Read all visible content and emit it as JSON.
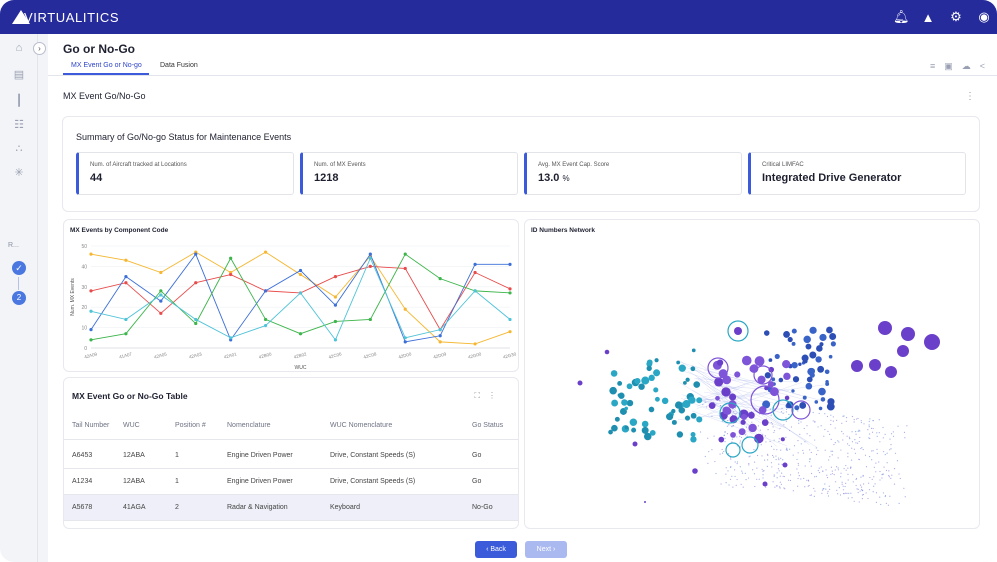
{
  "app": {
    "brand": "VIRTUALITICS",
    "top_icons": [
      "bell-icon",
      "alert-icon",
      "settings-icon",
      "user-icon"
    ]
  },
  "header": {
    "title": "Go or No-Go",
    "tabs": [
      {
        "label": "MX Event Go or No-go",
        "active": true
      },
      {
        "label": "Data Fusion",
        "active": false
      }
    ],
    "tools": [
      "filter-icon",
      "comment-icon",
      "cloud-icon",
      "share-icon"
    ]
  },
  "rail": {
    "items": [
      "home-icon",
      "document-icon",
      "bar-chart-icon",
      "dashboard-icon",
      "network-icon",
      "hub-icon"
    ],
    "step_label": "R...",
    "step_number": "2"
  },
  "section": {
    "title": "MX Event Go/No-Go"
  },
  "summary": {
    "title": "Summary of Go/No-go Status for Maintenance Events",
    "kpis": [
      {
        "label": "Num. of Aircraft tracked at Locations",
        "value": "44",
        "unit": ""
      },
      {
        "label": "Num. of MX Events",
        "value": "1218",
        "unit": ""
      },
      {
        "label": "Avg. MX Event Cap. Score",
        "value": "13.0",
        "unit": "%"
      },
      {
        "label": "Critical LIMFAC",
        "value": "Integrated Drive Generator",
        "unit": ""
      }
    ]
  },
  "line_chart": {
    "title": "MX Events by Component Code"
  },
  "chart_data": {
    "type": "line",
    "title": "MX Events by Component Code",
    "xlabel": "WUC",
    "ylabel": "Num. MX Events",
    "ylim": [
      0,
      50
    ],
    "yticks": [
      0,
      10,
      20,
      30,
      40,
      50
    ],
    "categories": [
      "42A09",
      "41A07",
      "42A05",
      "42A03",
      "42A01",
      "42B00",
      "42B02",
      "42C06",
      "42C08",
      "42D00",
      "42D09",
      "42G00",
      "42G30"
    ],
    "series": [
      {
        "color": "#f5b731",
        "values": [
          46,
          43,
          37,
          47,
          37,
          47,
          36,
          25,
          45,
          19,
          3,
          2,
          8
        ]
      },
      {
        "color": "#e84b4b",
        "values": [
          28,
          32,
          17,
          32,
          36,
          28,
          27,
          35,
          40,
          39,
          9,
          37,
          29
        ]
      },
      {
        "color": "#3c6fd8",
        "values": [
          9,
          35,
          23,
          46,
          4,
          28,
          38,
          21,
          46,
          3,
          6,
          41,
          41
        ]
      },
      {
        "color": "#3cb54a",
        "values": [
          4,
          7,
          28,
          12,
          44,
          14,
          7,
          13,
          14,
          46,
          34,
          28,
          27
        ]
      },
      {
        "color": "#4fc3d8",
        "values": [
          18,
          14,
          26,
          14,
          5,
          11,
          27,
          4,
          44,
          5,
          9,
          28,
          14
        ]
      }
    ]
  },
  "network": {
    "title": "ID Numbers Network"
  },
  "table": {
    "title": "MX Event Go or No-Go Table",
    "columns": [
      "Tail Number",
      "WUC",
      "Position #",
      "Nomenclature",
      "WUC  Nomenclature",
      "Go Status"
    ],
    "rows": [
      [
        "A6453",
        "12ABA",
        "1",
        "Engine Driven Power",
        "Drive, Constant Speeds (S)",
        "Go"
      ],
      [
        "A1234",
        "12ABA",
        "1",
        "Engine Driven Power",
        "Drive, Constant Speeds (S)",
        "Go"
      ],
      [
        "A5678",
        "41AGA",
        "2",
        "Radar & Navigation",
        "Keyboard",
        "No-Go"
      ]
    ]
  },
  "nav": {
    "back": "‹  Back",
    "next": "Next  ›"
  }
}
